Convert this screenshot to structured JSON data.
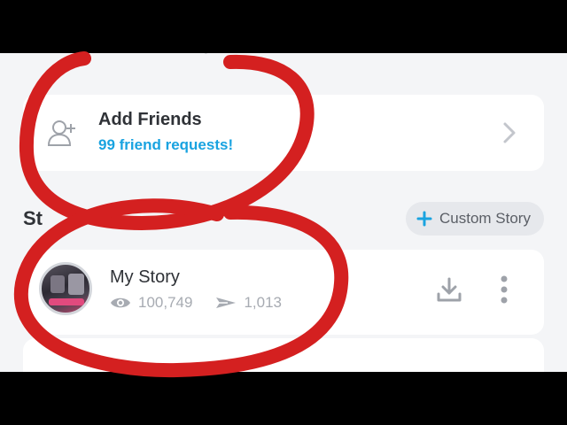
{
  "add_friends": {
    "title": "Add Friends",
    "subtitle": "99 friend requests!",
    "icon": "add-friend-icon",
    "chevron_icon": "chevron-right-icon"
  },
  "stories_section": {
    "title": "St",
    "custom_story_label": "Custom Story",
    "custom_story_icon": "plus-icon"
  },
  "my_story": {
    "title": "My Story",
    "views": "100,749",
    "screenshots_or_shares": "1,013",
    "views_icon": "eye-icon",
    "shares_icon": "plane-icon",
    "download_icon": "download-icon",
    "more_icon": "more-vertical-icon"
  },
  "colors": {
    "accent_blue": "#19a3e0",
    "annotation_red": "#d42020",
    "card_bg": "#ffffff",
    "screen_bg": "#f4f5f7"
  }
}
